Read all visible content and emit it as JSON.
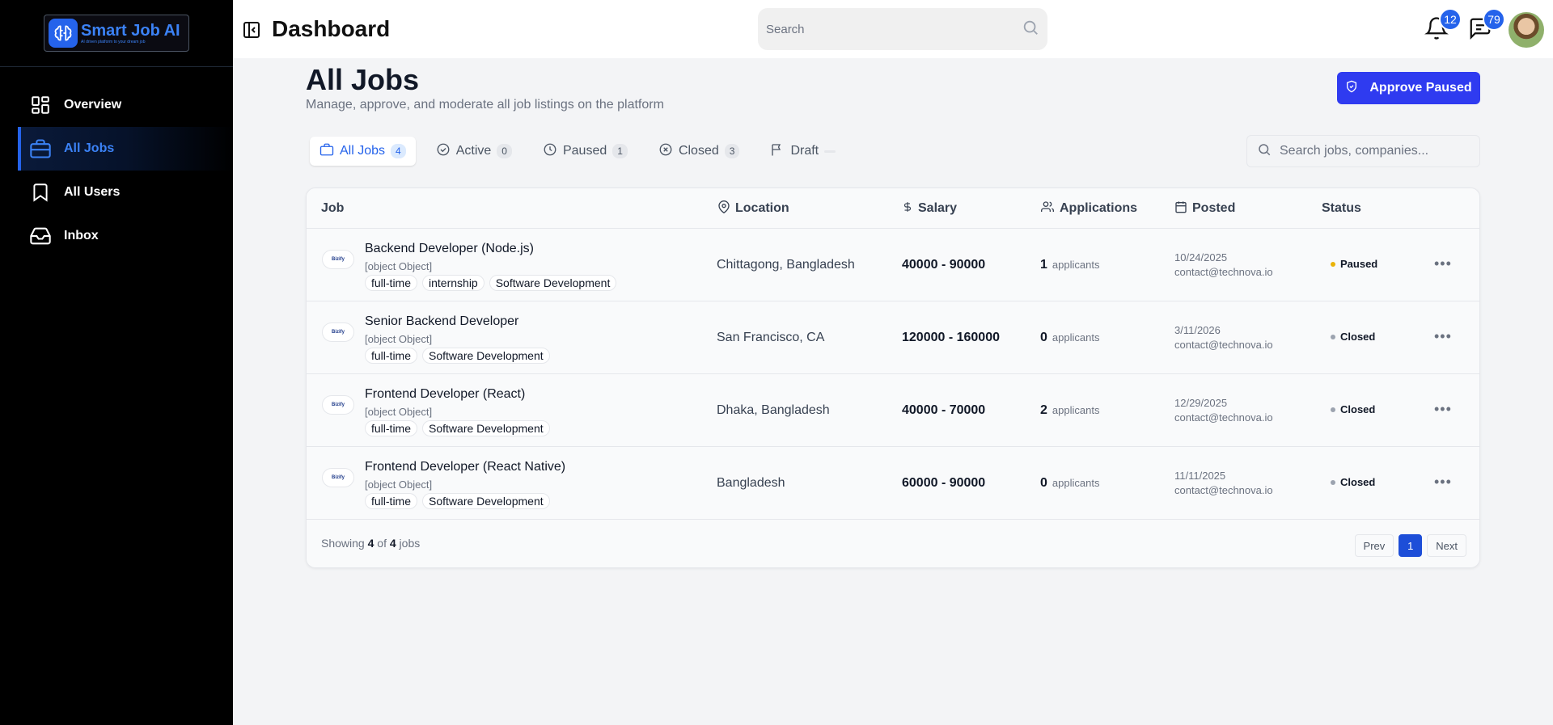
{
  "brand": {
    "name": "Smart Job AI",
    "tagline": "AI driven platform to your dream job",
    "accent": "#2563eb"
  },
  "sidebar": {
    "items": [
      {
        "label": "Overview",
        "icon": "grid-icon",
        "active": false
      },
      {
        "label": "All Jobs",
        "icon": "briefcase-icon",
        "active": true
      },
      {
        "label": "All Users",
        "icon": "bookmark-icon",
        "active": false
      },
      {
        "label": "Inbox",
        "icon": "inbox-icon",
        "active": false
      }
    ]
  },
  "header": {
    "title": "Dashboard",
    "search_placeholder": "Search",
    "notifications_count": "12",
    "messages_count": "79"
  },
  "main": {
    "title": "All Jobs",
    "subtitle": "Manage, approve, and moderate all job listings on the platform",
    "approve_label": "Approve Paused",
    "search_placeholder": "Search jobs, companies...",
    "tabs": [
      {
        "label": "All Jobs",
        "count": "4",
        "icon": "briefcase-icon"
      },
      {
        "label": "Active",
        "count": "0",
        "icon": "check-circle-icon"
      },
      {
        "label": "Paused",
        "count": "1",
        "icon": "clock-icon"
      },
      {
        "label": "Closed",
        "count": "3",
        "icon": "x-circle-icon"
      },
      {
        "label": "Draft",
        "count": "",
        "icon": "flag-icon"
      }
    ]
  },
  "table": {
    "columns": [
      "Job",
      "Location",
      "Salary",
      "Applications",
      "Posted",
      "Status"
    ],
    "applicants_label": "applicants",
    "rows": [
      {
        "title": "Backend Developer (Node.js)",
        "company": "[object Object]",
        "tags": [
          "full-time",
          "internship",
          "Software Development"
        ],
        "location": "Chittagong, Bangladesh",
        "salary": "40000 - 90000",
        "applications": "1",
        "date": "10/24/2025",
        "email": "contact@technova.io",
        "status": "Paused",
        "status_color": "#eab308"
      },
      {
        "title": "Senior Backend Developer",
        "company": "[object Object]",
        "tags": [
          "full-time",
          "Software Development"
        ],
        "location": "San Francisco, CA",
        "salary": "120000 - 160000",
        "applications": "0",
        "date": "3/11/2026",
        "email": "contact@technova.io",
        "status": "Closed",
        "status_color": "#9ca3af"
      },
      {
        "title": "Frontend Developer (React)",
        "company": "[object Object]",
        "tags": [
          "full-time",
          "Software Development"
        ],
        "location": "Dhaka, Bangladesh",
        "salary": "40000 - 70000",
        "applications": "2",
        "date": "12/29/2025",
        "email": "contact@technova.io",
        "status": "Closed",
        "status_color": "#9ca3af"
      },
      {
        "title": "Frontend Developer (React Native)",
        "company": "[object Object]",
        "tags": [
          "full-time",
          "Software Development"
        ],
        "location": "Bangladesh",
        "salary": "60000 - 90000",
        "applications": "0",
        "date": "11/11/2025",
        "email": "contact@technova.io",
        "status": "Closed",
        "status_color": "#9ca3af"
      }
    ],
    "logo_text": "Bizify",
    "footer": {
      "showing_prefix": "Showing",
      "shown": "4",
      "of": "of",
      "total": "4",
      "suffix": "jobs"
    },
    "pager": {
      "prev": "Prev",
      "current": "1",
      "next": "Next"
    }
  }
}
